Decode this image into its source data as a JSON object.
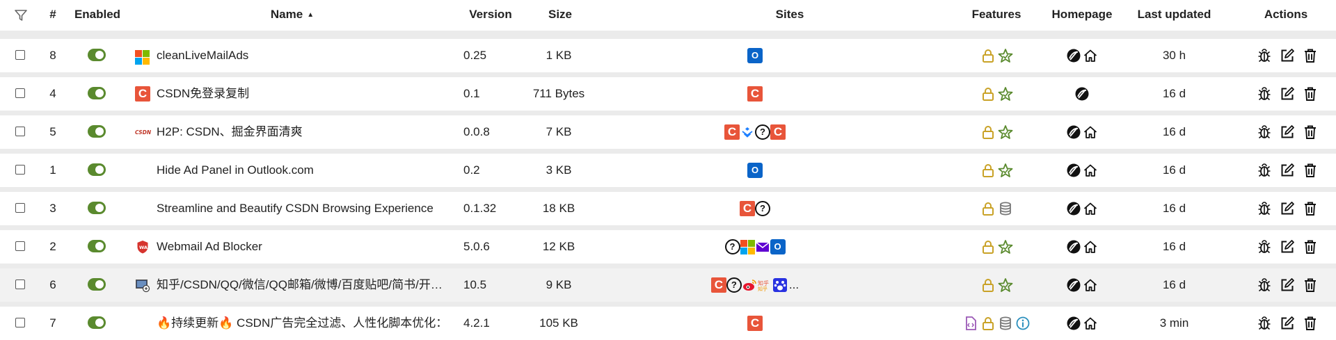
{
  "header": {
    "col_num": "#",
    "col_enabled": "Enabled",
    "col_name": "Name",
    "col_version": "Version",
    "col_size": "Size",
    "col_sites": "Sites",
    "col_features": "Features",
    "col_homepage": "Homepage",
    "col_updated": "Last updated",
    "col_actions": "Actions",
    "sort_indicator": "▲"
  },
  "colors": {
    "toggle_on": "#5a8a2e",
    "csdn": "#e8553a",
    "outlook": "#0a64c8",
    "lock": "#c9a227",
    "star": "#5a8a2e"
  },
  "rows": [
    {
      "num": "8",
      "name": "cleanLiveMailAds",
      "version": "0.25",
      "size": "1 KB",
      "updated": "30 h",
      "icon": "microsoft-icon",
      "sites": [
        "outlook-icon"
      ],
      "features": [
        "lock-icon",
        "star-icon"
      ],
      "homepage": [
        "globe-icon",
        "home-icon"
      ]
    },
    {
      "num": "4",
      "name": "CSDN免登录复制",
      "version": "0.1",
      "size": "711 Bytes",
      "updated": "16 d",
      "icon": "csdn-icon",
      "sites": [
        "csdn-icon"
      ],
      "features": [
        "lock-icon",
        "star-icon"
      ],
      "homepage": [
        "globe-icon"
      ]
    },
    {
      "num": "5",
      "name": "H2P: CSDN、掘金界面清爽",
      "version": "0.0.8",
      "size": "7 KB",
      "updated": "16 d",
      "icon": "csdn-text-icon",
      "sites": [
        "csdn-icon",
        "juejin-icon",
        "unknown-icon",
        "csdn-icon"
      ],
      "features": [
        "lock-icon",
        "star-icon"
      ],
      "homepage": [
        "globe-icon",
        "home-icon"
      ]
    },
    {
      "num": "1",
      "name": "Hide Ad Panel in Outlook.com",
      "version": "0.2",
      "size": "3 KB",
      "updated": "16 d",
      "icon": "",
      "sites": [
        "outlook-icon"
      ],
      "features": [
        "lock-icon",
        "star-icon"
      ],
      "homepage": [
        "globe-icon",
        "home-icon"
      ]
    },
    {
      "num": "3",
      "name": "Streamline and Beautify CSDN Browsing Experience",
      "version": "0.1.32",
      "size": "18 KB",
      "updated": "16 d",
      "icon": "",
      "sites": [
        "csdn-icon",
        "unknown-icon"
      ],
      "features": [
        "lock-icon",
        "database-icon"
      ],
      "homepage": [
        "globe-icon",
        "home-icon"
      ]
    },
    {
      "num": "2",
      "name": "Webmail Ad Blocker",
      "version": "5.0.6",
      "size": "12 KB",
      "updated": "16 d",
      "icon": "shield-icon",
      "sites": [
        "unknown-icon",
        "microsoft-icon",
        "yahoo-mail-icon",
        "outlook-icon"
      ],
      "features": [
        "lock-icon",
        "star-icon"
      ],
      "homepage": [
        "globe-icon",
        "home-icon"
      ]
    },
    {
      "num": "6",
      "name": "知乎/CSDN/QQ/微信/QQ邮箱/微博/百度贴吧/简书/开…",
      "version": "10.5",
      "size": "9 KB",
      "updated": "16 d",
      "icon": "app-icon",
      "sites": [
        "csdn-icon",
        "unknown-icon",
        "weibo-icon",
        "zhihu-icon",
        "baidu-icon"
      ],
      "sites_more": "...",
      "features": [
        "lock-icon",
        "star-icon"
      ],
      "homepage": [
        "globe-icon",
        "home-icon"
      ]
    },
    {
      "num": "7",
      "name": "🔥持续更新🔥 CSDN广告完全过滤、人性化脚本优化：…",
      "version": "4.2.1",
      "size": "105 KB",
      "updated": "3 min",
      "icon": "",
      "sites": [
        "csdn-icon"
      ],
      "features": [
        "code-file-icon",
        "lock-icon",
        "database-icon",
        "info-icon"
      ],
      "homepage": [
        "globe-icon",
        "home-icon"
      ]
    }
  ]
}
